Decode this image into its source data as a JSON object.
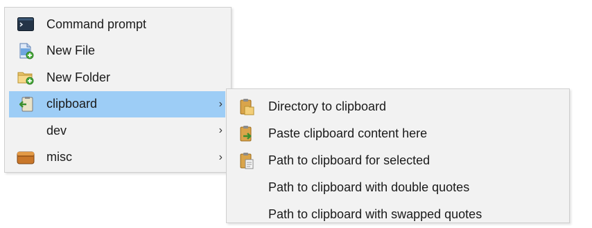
{
  "main_menu": {
    "items": [
      {
        "label": "Command prompt",
        "icon": "command-prompt-icon",
        "submenu": false
      },
      {
        "label": "New File",
        "icon": "new-file-icon",
        "submenu": false
      },
      {
        "label": "New Folder",
        "icon": "new-folder-icon",
        "submenu": false
      },
      {
        "label": "clipboard",
        "icon": "clipboard-icon",
        "submenu": true,
        "highlighted": true
      },
      {
        "label": "dev",
        "icon": "",
        "submenu": true
      },
      {
        "label": "misc",
        "icon": "misc-box-icon",
        "submenu": true
      }
    ],
    "chevron": "›"
  },
  "clipboard_submenu": {
    "items": [
      {
        "label": "Directory to clipboard",
        "icon": "folder-clipboard-icon"
      },
      {
        "label": "Paste clipboard content here",
        "icon": "paste-clipboard-icon"
      },
      {
        "label": "Path to clipboard for selected",
        "icon": "path-clipboard-icon"
      },
      {
        "label": "Path to clipboard with double quotes",
        "icon": ""
      },
      {
        "label": "Path to clipboard with swapped quotes",
        "icon": ""
      }
    ]
  },
  "colors": {
    "menu_bg": "#f2f2f2",
    "highlight": "#9dcdf6",
    "text": "#1a1a1a"
  }
}
